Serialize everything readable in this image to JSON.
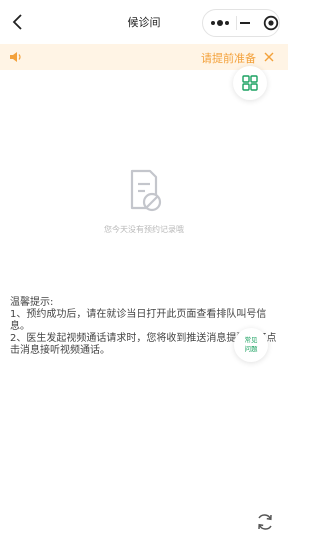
{
  "nav": {
    "title": "候诊间",
    "back_icon": "back-arrow-icon",
    "more_icon": "more-dots-icon",
    "minimize_icon": "minimize-icon",
    "close_icon": "record-target-icon"
  },
  "notice": {
    "text": "请提前准备",
    "icon": "speaker-icon",
    "close_icon": "close-icon",
    "accent": "#f3a13b",
    "background": "#fff4e5"
  },
  "grid_button": {
    "icon": "grid-apps-icon",
    "color": "#1aa160"
  },
  "empty": {
    "icon": "no-record-doc-icon",
    "text": "您今天没有预约记录哦"
  },
  "tips": {
    "title": "温馨提示:",
    "line1": "1、预约成功后，请在就诊当日打开此页面查看排队叫号信息。",
    "line2": "2、医生发起视频通话请求时，您将收到推送消息提醒，可点击消息接听视频通话。"
  },
  "faq": {
    "line1": "常见",
    "line2": "问题",
    "color": "#1aa160"
  },
  "refresh_icon": "refresh-icon"
}
